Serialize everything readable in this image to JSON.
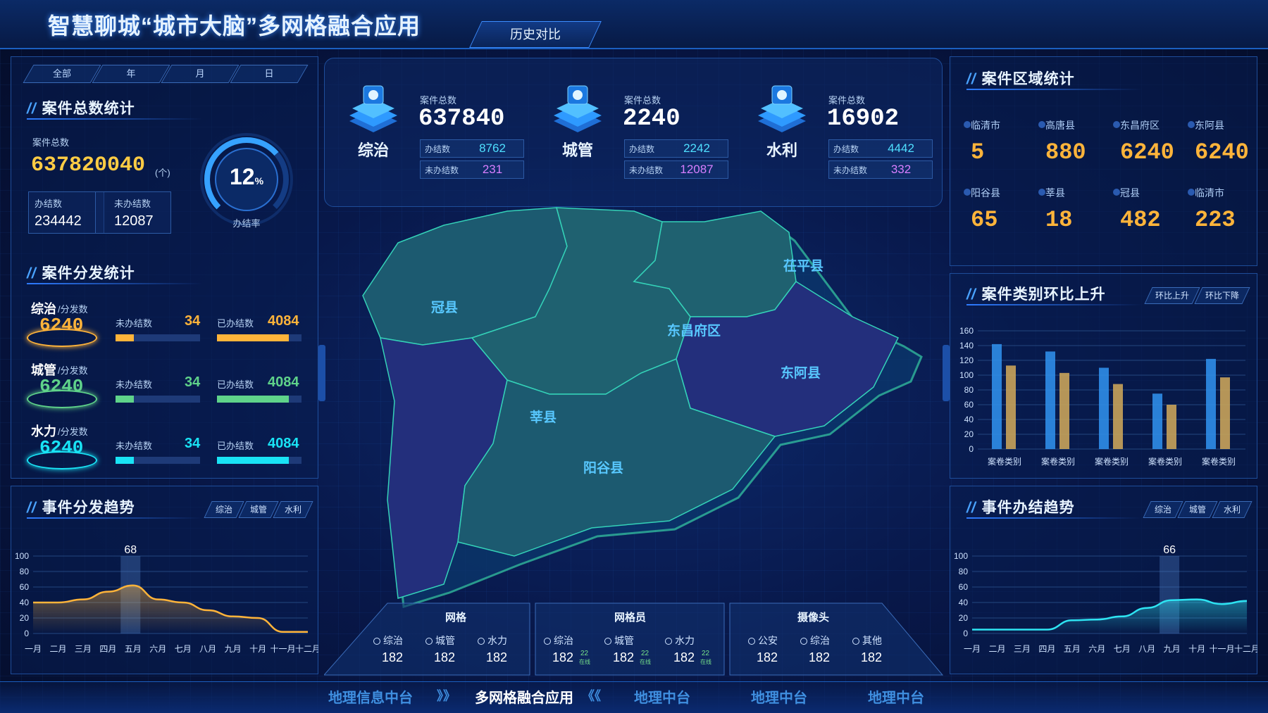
{
  "header": {
    "title": "智慧聊城“城市大脑”多网格融合应用",
    "history_btn": "历史对比"
  },
  "period_tabs": [
    "全部",
    "年",
    "月",
    "日"
  ],
  "total_stats": {
    "title": "案件总数统计",
    "total_label": "案件总数",
    "total_value": "637820040",
    "unit": "(个)",
    "done_label": "办结数",
    "done_value": "234442",
    "undone_label": "未办结数",
    "undone_value": "12087",
    "rate_value": "12",
    "rate_unit": "%",
    "rate_label": "办结率"
  },
  "distribution": {
    "title": "案件分发统计",
    "rows": [
      {
        "name": "综治",
        "sub": "/分发数",
        "count": "6240",
        "undone_label": "未办结数",
        "undone": "34",
        "done_label": "已办结数",
        "done": "4084",
        "color": "#ffb43a",
        "undone_frac": 0.22,
        "done_frac": 0.85
      },
      {
        "name": "城管",
        "sub": "/分发数",
        "count": "6240",
        "undone_label": "未办结数",
        "undone": "34",
        "done_label": "已办结数",
        "done": "4084",
        "color": "#5fd38a",
        "undone_frac": 0.22,
        "done_frac": 0.85
      },
      {
        "name": "水力",
        "sub": "/分发数",
        "count": "6240",
        "undone_label": "未办结数",
        "undone": "34",
        "done_label": "已办结数",
        "done": "4084",
        "color": "#19e3f5",
        "undone_frac": 0.22,
        "done_frac": 0.85
      }
    ]
  },
  "top_cards": [
    {
      "icon": "综治",
      "label": "案件总数",
      "value": "637840",
      "done_label": "办结数",
      "done": "8762",
      "undone_label": "未办结数",
      "undone": "231"
    },
    {
      "icon": "城管",
      "label": "案件总数",
      "value": "2240",
      "done_label": "办结数",
      "done": "2242",
      "undone_label": "未办结数",
      "undone": "12087"
    },
    {
      "icon": "水利",
      "label": "案件总数",
      "value": "16902",
      "done_label": "办结数",
      "done": "4442",
      "undone_label": "未办结数",
      "undone": "332"
    }
  ],
  "map_labels": [
    "冠县",
    "东昌府区",
    "茌平县",
    "东阿县",
    "莘县",
    "阳谷县"
  ],
  "bottom_stats": {
    "groups": [
      {
        "title": "网格",
        "items": [
          {
            "label": "综治",
            "value": "182"
          },
          {
            "label": "城管",
            "value": "182"
          },
          {
            "label": "水力",
            "value": "182"
          }
        ]
      },
      {
        "title": "网格员",
        "items": [
          {
            "label": "综治",
            "value": "182",
            "sub": "22",
            "sub2": "在线"
          },
          {
            "label": "城管",
            "value": "182",
            "sub": "22",
            "sub2": "在线"
          },
          {
            "label": "水力",
            "value": "182",
            "sub": "22",
            "sub2": "在线"
          }
        ]
      },
      {
        "title": "摄像头",
        "items": [
          {
            "label": "公安",
            "value": "182"
          },
          {
            "label": "综治",
            "value": "182"
          },
          {
            "label": "其他",
            "value": "182"
          }
        ]
      }
    ]
  },
  "nav": {
    "items": [
      "地理信息中台",
      "多网格融合应用",
      "地理中台",
      "地理中台",
      "地理中台"
    ],
    "active": "多网格融合应用",
    "arrows_left": "》》",
    "arrows_right": "《《"
  },
  "region_stats": {
    "title": "案件区域统计",
    "items": [
      {
        "name": "临清市",
        "value": "5"
      },
      {
        "name": "高唐县",
        "value": "880"
      },
      {
        "name": "东昌府区",
        "value": "6240"
      },
      {
        "name": "东阿县",
        "value": "6240"
      },
      {
        "name": "阳谷县",
        "value": "65"
      },
      {
        "name": "莘县",
        "value": "18"
      },
      {
        "name": "冠县",
        "value": "482"
      },
      {
        "name": "临清市",
        "value": "223"
      }
    ]
  },
  "category_rise": {
    "title": "案件类别环比上升",
    "tab1": "环比上升",
    "tab2": "环比下降"
  },
  "event_trend": {
    "title": "事件分发趋势",
    "tabs": [
      "综治",
      "城管",
      "水利"
    ]
  },
  "finish_trend": {
    "title": "事件办结趋势",
    "tabs": [
      "综治",
      "城管",
      "水利"
    ]
  },
  "chart_data": [
    {
      "type": "bar",
      "title": "",
      "categories": [
        "案卷类别",
        "案卷类别",
        "案卷类别",
        "案卷类别",
        "案卷类别"
      ],
      "series": [
        {
          "values": [
            142,
            132,
            110,
            75,
            122
          ]
        },
        {
          "values": [
            113,
            103,
            88,
            60,
            97
          ]
        }
      ],
      "ylim": [
        0,
        160
      ],
      "yticks": [
        0,
        20,
        40,
        60,
        80,
        100,
        120,
        140,
        160
      ],
      "colors": [
        "#2f8de8",
        "#c9a35a"
      ]
    },
    {
      "type": "area",
      "title": "",
      "x": [
        "一月",
        "二月",
        "三月",
        "四月",
        "五月",
        "六月",
        "七月",
        "八月",
        "九月",
        "十月",
        "十一月",
        "十二月"
      ],
      "values": [
        40,
        40,
        44,
        54,
        62,
        44,
        40,
        30,
        22,
        20,
        2,
        2
      ],
      "highlight_label": "68",
      "highlight_index": 3.9,
      "ylim": [
        0,
        100
      ],
      "yticks": [
        0,
        20,
        40,
        60,
        80,
        100
      ],
      "color": "#ffb43a"
    },
    {
      "type": "area",
      "title": "",
      "x": [
        "一月",
        "二月",
        "三月",
        "四月",
        "五月",
        "六月",
        "七月",
        "八月",
        "九月",
        "十月",
        "十一月",
        "十二月"
      ],
      "values": [
        5,
        5,
        5,
        5,
        17,
        18,
        22,
        33,
        43,
        44,
        38,
        42
      ],
      "highlight_label": "66",
      "highlight_index": 7.9,
      "ylim": [
        0,
        100
      ],
      "yticks": [
        0,
        20,
        40,
        60,
        80,
        100
      ],
      "color": "#2ee4f2"
    }
  ]
}
